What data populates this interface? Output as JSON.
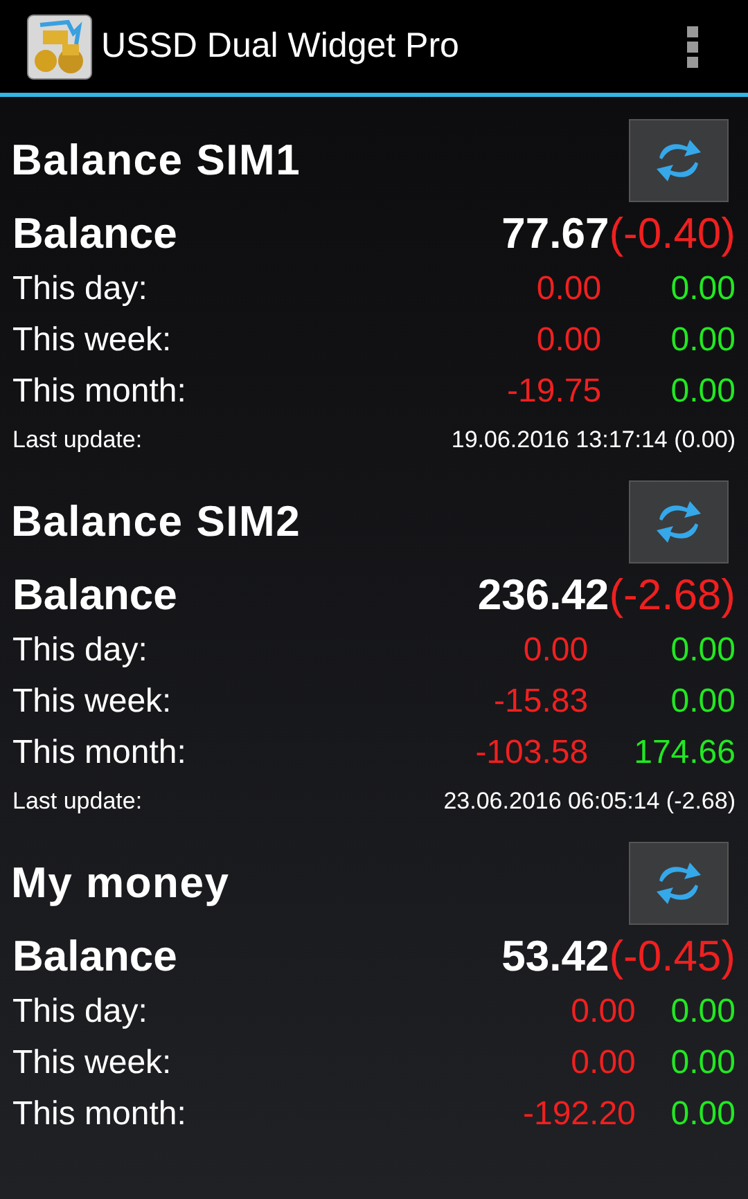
{
  "app_bar": {
    "title": "USSD Dual Widget Pro"
  },
  "sections": [
    {
      "title": "Balance SIM1",
      "balance_label": "Balance",
      "balance": "77.67",
      "balance_change": "(-0.40)",
      "rows": [
        {
          "label": "This day:",
          "spent": "0.00",
          "received": "0.00"
        },
        {
          "label": "This week:",
          "spent": "0.00",
          "received": "0.00"
        },
        {
          "label": "This month:",
          "spent": "-19.75",
          "received": "0.00"
        }
      ],
      "last_update_label": "Last update:",
      "last_update": "19.06.2016 13:17:14 (0.00)"
    },
    {
      "title": "Balance SIM2",
      "balance_label": "Balance",
      "balance": "236.42",
      "balance_change": "(-2.68)",
      "rows": [
        {
          "label": "This day:",
          "spent": "0.00",
          "received": "0.00"
        },
        {
          "label": "This week:",
          "spent": "-15.83",
          "received": "0.00"
        },
        {
          "label": "This month:",
          "spent": "-103.58",
          "received": "174.66"
        }
      ],
      "last_update_label": "Last update:",
      "last_update": "23.06.2016 06:05:14 (-2.68)"
    },
    {
      "title": "My money",
      "balance_label": "Balance",
      "balance": "53.42",
      "balance_change": "(-0.45)",
      "rows": [
        {
          "label": "This day:",
          "spent": "0.00",
          "received": "0.00"
        },
        {
          "label": "This week:",
          "spent": "0.00",
          "received": "0.00"
        },
        {
          "label": "This month:",
          "spent": "-192.20",
          "received": "0.00"
        }
      ]
    }
  ]
}
